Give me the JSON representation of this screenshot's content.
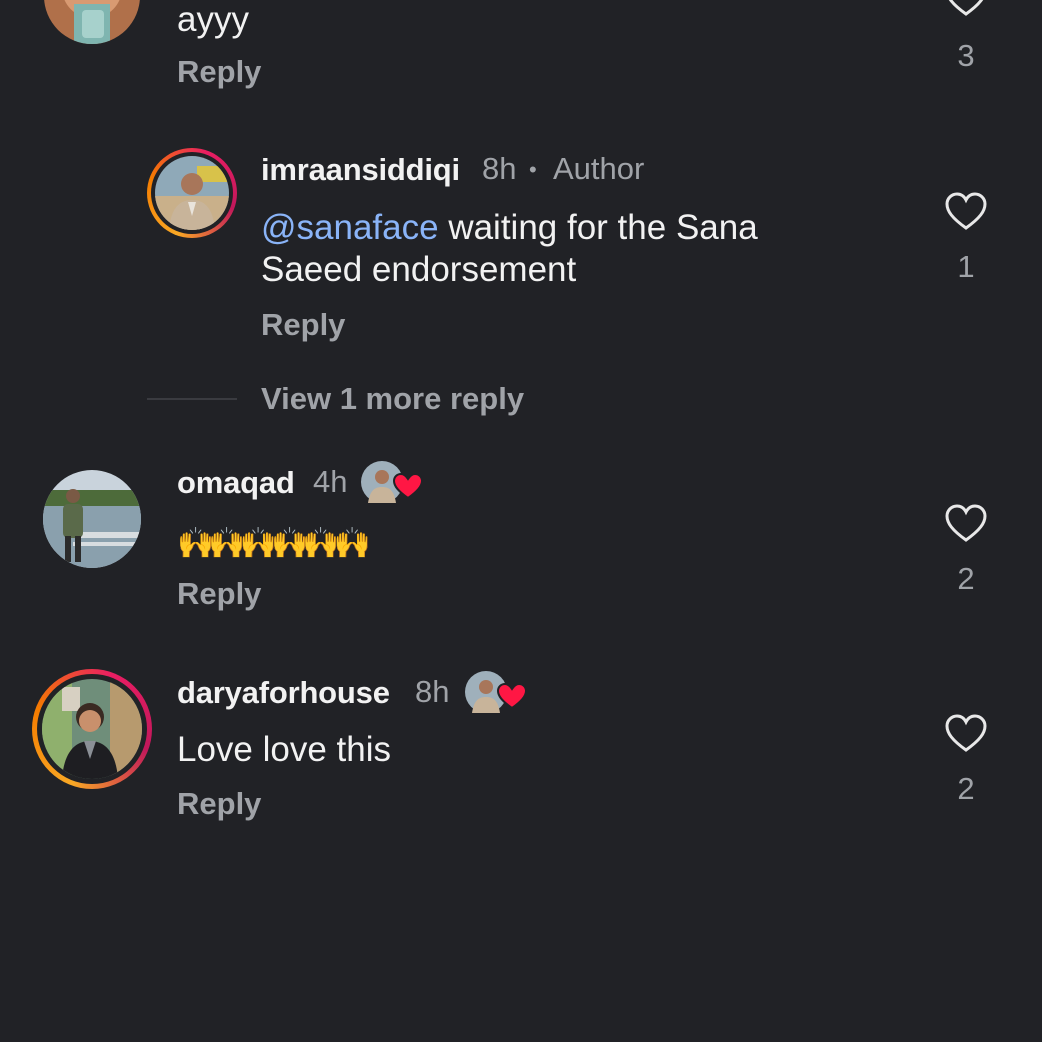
{
  "comments": [
    {
      "text": "ayyy",
      "reply_label": "Reply",
      "likes": "3"
    },
    {
      "username": "imraansiddiqi",
      "time": "8h",
      "separator": "•",
      "badge": "Author",
      "mention": "@sanaface",
      "text_line1": " waiting for the Sana",
      "text_line2": "Saeed endorsement",
      "reply_label": "Reply",
      "likes": "1",
      "view_more": "View 1 more reply"
    },
    {
      "username": "omaqad",
      "time": "4h",
      "text": "🙌🙌🙌🙌🙌🙌",
      "reply_label": "Reply",
      "likes": "2"
    },
    {
      "username": "daryaforhouse",
      "time": "8h",
      "text": "Love love this",
      "reply_label": "Reply",
      "likes": "2"
    }
  ],
  "colors": {
    "background": "#212226",
    "mention": "#8ab4f8",
    "secondary_text": "#a0a3a8",
    "liked_heart": "#ff1744"
  },
  "icons": [
    "heart-outline-icon",
    "author-liked-heart-icon"
  ]
}
